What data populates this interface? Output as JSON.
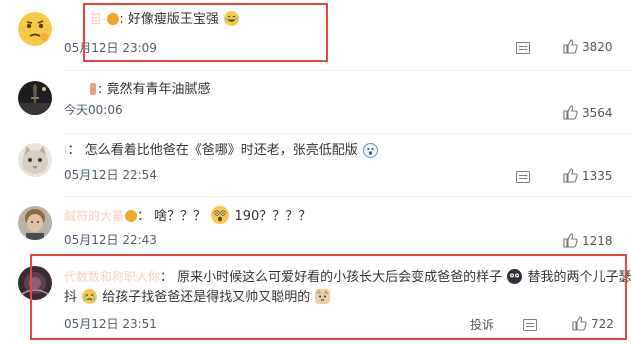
{
  "comments": [
    {
      "name": "苗-",
      "separator": ":",
      "text": "好像瘦版王宝强",
      "time": "05月12日 23:09",
      "likes": "3820"
    },
    {
      "name": "",
      "separator": ":",
      "text": "竟然有青年油腻感",
      "time": "今天00:06",
      "likes": "3564"
    },
    {
      "name": "I",
      "separator": "：",
      "text": "怎么看着比他爸在《爸哪》时还老，张亮低配版",
      "time": "05月12日 22:54",
      "likes": "1335"
    },
    {
      "name": "鹹符的大蕃",
      "separator": "：",
      "text_a": "啥？？？",
      "text_b": "190？？？？",
      "time": "05月12日 22:43",
      "likes": "1218"
    },
    {
      "name": "代数数和称职人你",
      "separator": "：",
      "text_a": "原来小时候这么可爱好看的小孩长大后会变成爸爸的样子",
      "text_b": "替我的两个儿子瑟瑟发",
      "text_c": "抖",
      "text_d": "给孩子找爸爸还是得找又帅又聪明的",
      "time": "05月12日 23:51",
      "report": "投诉",
      "likes": "722"
    }
  ],
  "colors": {
    "username": "#eb7350",
    "highlight": "#e44a3a",
    "timestamp": "#4d5c6e"
  },
  "icons": [
    "reply-icon",
    "thumbs-up-icon",
    "laughing-emoji",
    "shocked-emoji",
    "cat-emoji",
    "crying-emoji",
    "ghost-emoji"
  ]
}
